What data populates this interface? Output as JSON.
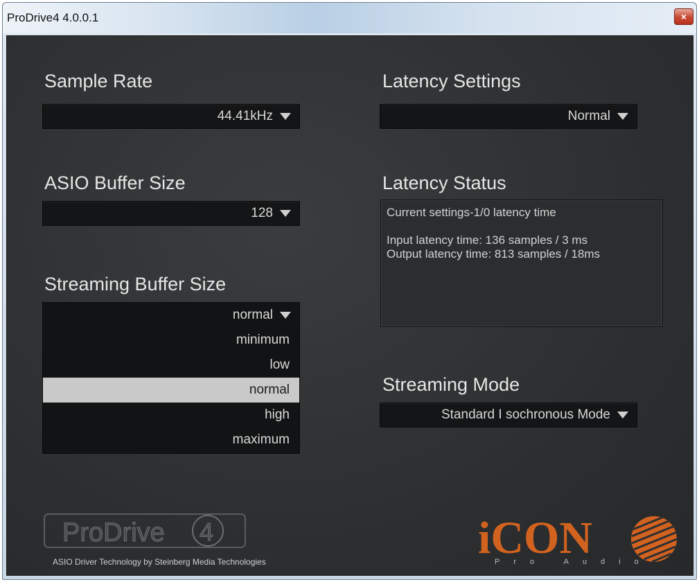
{
  "window": {
    "title": "ProDrive4 4.0.0.1",
    "close_glyph": "×"
  },
  "sample_rate": {
    "heading": "Sample Rate",
    "value": "44.41kHz"
  },
  "asio_buffer": {
    "heading": "ASIO Buffer Size",
    "value": "128"
  },
  "streaming_buffer": {
    "heading": "Streaming Buffer Size",
    "value": "normal",
    "options": [
      "minimum",
      "low",
      "normal",
      "high",
      "maximum"
    ],
    "selected_index": 2
  },
  "latency_settings": {
    "heading": "Latency Settings",
    "value": "Normal"
  },
  "latency_status": {
    "heading": "Latency Status",
    "line1": "Current settings-1/0 latency time",
    "line2": "Input latency time: 136 samples / 3 ms",
    "line3": "Output latency time: 813 samples / 18ms"
  },
  "streaming_mode": {
    "heading": "Streaming Mode",
    "value": "Standard I sochronous Mode"
  },
  "footer": {
    "prodrive_logo_text": "ProDrive",
    "prodrive_logo_number": "4",
    "credit": "ASIO Driver Technology by Steinberg Media Technologies",
    "icon_logo_text": "iCON",
    "icon_logo_sub": "Pro Audio"
  },
  "colors": {
    "panel_bg": "#2d2f31",
    "dropdown_bg": "#141516",
    "selected_option_bg": "#c9c9c9",
    "icon_brand_orange": "#d2621f"
  }
}
